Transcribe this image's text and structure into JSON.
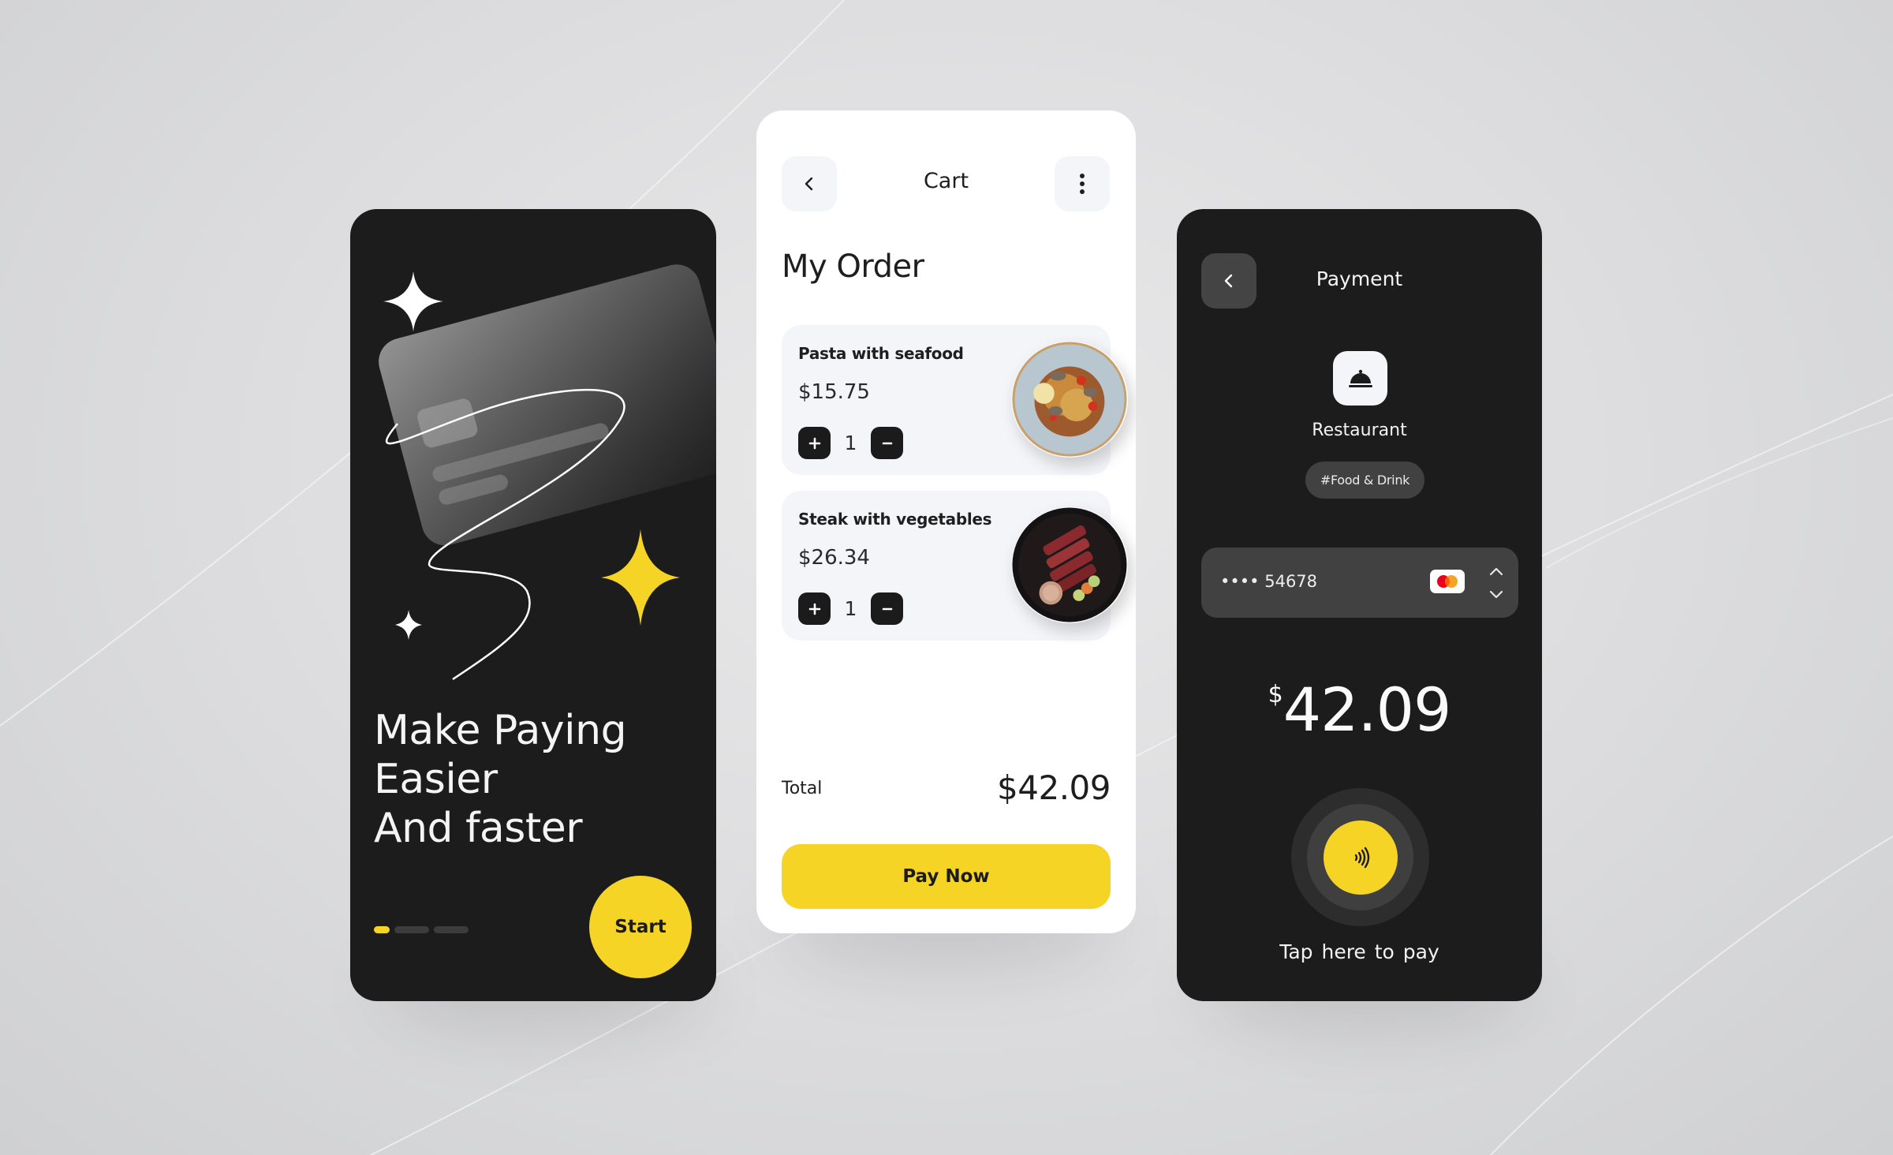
{
  "colors": {
    "accent": "#f6d426",
    "dark_surface": "#1c1c1d",
    "light_surface": "#ffffff",
    "card_bg": "#f4f5f9",
    "chip_dark": "#414142"
  },
  "onboarding": {
    "headline_lines": [
      "Make Paying",
      "Easier",
      "And faster"
    ],
    "pagination": {
      "total": 3,
      "active_index": 0
    },
    "start_label": "Start",
    "icons": [
      "sparkle-icon",
      "credit-card-illustration"
    ]
  },
  "cart": {
    "title": "Cart",
    "back_icon": "chevron-left-icon",
    "menu_icon": "more-vertical-icon",
    "heading": "My Order",
    "items": [
      {
        "name": "Pasta with seafood",
        "price": "$15.75",
        "quantity": "1",
        "image": "pasta-plate"
      },
      {
        "name": "Steak with vegetables",
        "price": "$26.34",
        "quantity": "1",
        "image": "steak-plate"
      }
    ],
    "plus_icon": "plus-icon",
    "minus_icon": "minus-icon",
    "total_label": "Total",
    "total_value": "$42.09",
    "pay_button": "Pay Now"
  },
  "payment": {
    "title": "Payment",
    "back_icon": "chevron-left-icon",
    "merchant_icon": "cloche-icon",
    "merchant_name": "Restaurant",
    "tag": "#Food & Drink",
    "card_masked": "•••• 54678",
    "card_brand": "mastercard",
    "amount_currency": "$",
    "amount_value": "42.09",
    "tap_icon": "contactless-icon",
    "tap_label": "Tap  here to pay"
  }
}
